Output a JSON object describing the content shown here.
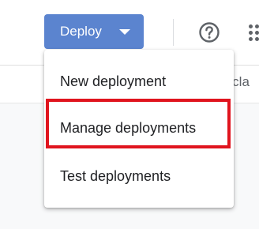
{
  "header": {
    "deploy_label": "Deploy",
    "help_icon": "help-circle-icon",
    "apps_icon": "apps-grid-icon"
  },
  "background": {
    "partial_text": "e cla"
  },
  "deploy_menu": {
    "items": [
      {
        "label": "New deployment"
      },
      {
        "label": "Manage deployments"
      },
      {
        "label": "Test deployments"
      }
    ],
    "highlighted_index": 1
  },
  "colors": {
    "deploy_button": "#5b84cf",
    "highlight": "#e0141e",
    "icon": "#5f6368",
    "menu_text": "#202124"
  }
}
